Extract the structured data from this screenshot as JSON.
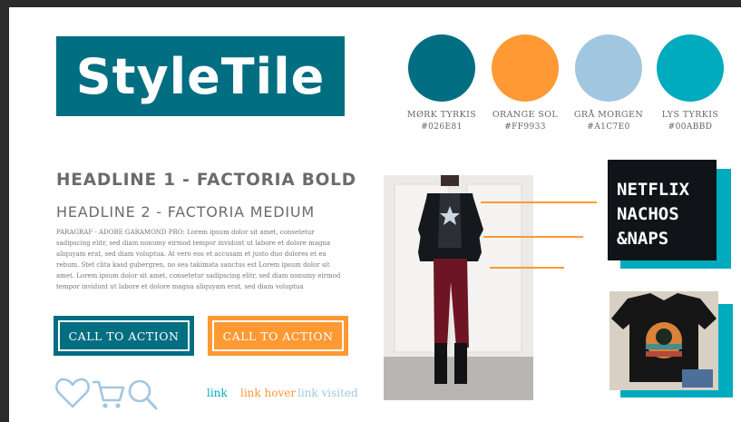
{
  "logo": {
    "text": "StyleTile"
  },
  "palette": [
    {
      "name": "MØRK TYRKIS",
      "hex": "#026E81",
      "color": "#026E81"
    },
    {
      "name": "ORANGE SOL",
      "hex": "#FF9933",
      "color": "#FF9933"
    },
    {
      "name": "GRÅ MORGEN",
      "hex": "#A1C7E0",
      "color": "#A1C7E0"
    },
    {
      "name": "LYS TYRKIS",
      "hex": "#00ABBD",
      "color": "#00ABBD"
    }
  ],
  "typography": {
    "headline1": "HEADLINE 1 - FACTORIA BOLD",
    "headline2": "HEADLINE 2 - FACTORIA MEDIUM",
    "paragraph": "PARAGRAF - ADOBE GARAMOND PRO: Lorem ipsum dolor sit amet, consetetur sadipscing elitr, sed diam nonumy eirmod tempor invidunt ut labore et dolore magna aliquyam erat, sed diam voluptua. At vero eos et accusam et justo duo dolores et ea rebum. Stet clita kasd gubergren, no sea takimata sanctus est Lorem ipsum dolor sit amet. Lorem ipsum dolor sit amet, consetetur sadipscing elitr, sed diam nonumy eirmod tempor invidunt ut labore et dolore magna aliquyam erat, sed diam voluptua"
  },
  "buttons": {
    "primary": {
      "label": "CALL TO ACTION",
      "color": "#026E81"
    },
    "secondary": {
      "label": "CALL TO ACTION",
      "color": "#FF9933"
    }
  },
  "icons": [
    "heart-icon",
    "cart-icon",
    "search-icon"
  ],
  "links": {
    "link": {
      "label": "link",
      "color": "#00ABBD"
    },
    "hover": {
      "label": "link hover",
      "color": "#FF9933"
    },
    "visited": {
      "label": "link visited",
      "color": "#A1C7E0"
    }
  },
  "shirt1": {
    "lines": [
      "NETFLIX",
      "NACHOS",
      "&NAPS"
    ]
  }
}
